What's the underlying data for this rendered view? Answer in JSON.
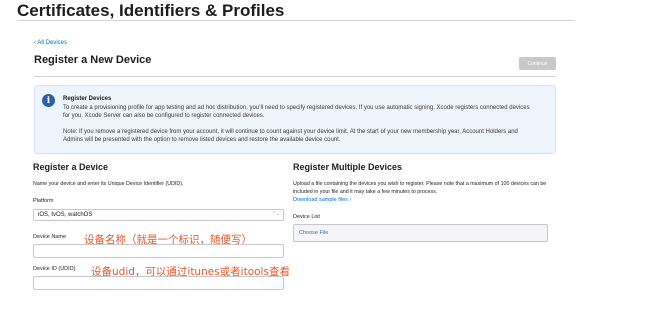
{
  "page": {
    "title": "Certificates, Identifiers & Profiles",
    "back_link": "‹ All Devices",
    "heading": "Register a New Device",
    "continue_label": "Continue"
  },
  "info": {
    "icon": "info-icon",
    "title": "Register Devices",
    "paragraph1": "To create a provisioning profile for app testing and ad hoc distribution, you’ll need to specify registered devices. If you use automatic signing, Xcode registers connected devices for you. Xcode Server can also be configured to register connected devices.",
    "paragraph2": "Note: If you remove a registered device from your account, it will continue to count against your device limit. At the start of your new membership year, Account Holders and Admins will be presented with the option to remove listed devices and restore the available device count."
  },
  "register_device": {
    "title": "Register a Device",
    "description": "Name your device and enter its Unique Device Identifier (UDID).",
    "platform_label": "Platform",
    "platform_value": "iOS, tvOS, watchOS",
    "device_name_label": "Device Name",
    "device_name_value": "",
    "device_id_label": "Device ID (UDID)",
    "device_id_value": ""
  },
  "register_multiple": {
    "title": "Register Multiple Devices",
    "description": "Upload a file containing the devices you wish to register. Please note that a maximum of 100 devices can be included in your file and it may take a few minutes to process.",
    "sample_link": "Download sample files ›",
    "device_list_label": "Device List",
    "choose_file_label": "Choose File"
  },
  "annotations": {
    "device_name_note": "设备名称（就是一个标识，随便写）",
    "device_id_note": "设备udid，可以通过itunes或者itools查看"
  },
  "colors": {
    "link": "#0070c9",
    "annotation": "#e0582a",
    "info_background": "#eef4fb",
    "button_disabled": "#c7c7cc"
  }
}
